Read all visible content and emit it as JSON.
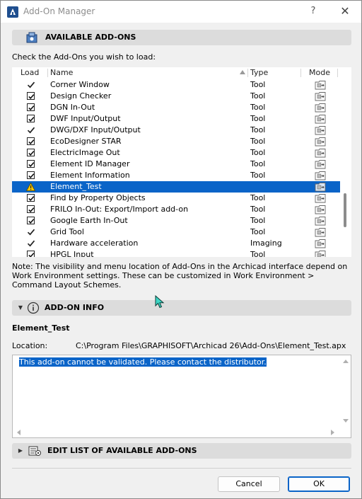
{
  "window": {
    "title": "Add-On Manager",
    "help_label": "?",
    "close_label": "✕"
  },
  "available": {
    "header": "AVAILABLE ADD-ONS",
    "instruction": "Check the Add-Ons you wish to load:"
  },
  "table": {
    "columns": {
      "load": "Load",
      "name": "Name",
      "type": "Type",
      "mode": "Mode"
    },
    "rows": [
      {
        "name": "Corner Window",
        "type": "Tool",
        "load": "tick"
      },
      {
        "name": "Design Checker",
        "type": "Tool",
        "load": "checked"
      },
      {
        "name": "DGN In-Out",
        "type": "Tool",
        "load": "checked"
      },
      {
        "name": "DWF Input/Output",
        "type": "Tool",
        "load": "checked"
      },
      {
        "name": "DWG/DXF Input/Output",
        "type": "Tool",
        "load": "tick"
      },
      {
        "name": "EcoDesigner STAR",
        "type": "Tool",
        "load": "checked"
      },
      {
        "name": "ElectricImage Out",
        "type": "Tool",
        "load": "checked"
      },
      {
        "name": "Element ID Manager",
        "type": "Tool",
        "load": "checked"
      },
      {
        "name": "Element Information",
        "type": "Tool",
        "load": "checked"
      },
      {
        "name": "Element_Test",
        "type": "",
        "load": "warning",
        "selected": true
      },
      {
        "name": "Find by Property Objects",
        "type": "Tool",
        "load": "checked"
      },
      {
        "name": "FRILO In-Out: Export/Import add-on",
        "type": "Tool",
        "load": "checked"
      },
      {
        "name": "Google Earth In-Out",
        "type": "Tool",
        "load": "checked"
      },
      {
        "name": "Grid Tool",
        "type": "Tool",
        "load": "tick"
      },
      {
        "name": "Hardware acceleration",
        "type": "Imaging",
        "load": "tick"
      },
      {
        "name": "HPGL Input",
        "type": "Tool",
        "load": "checked"
      }
    ]
  },
  "note": "Note: The visibility and menu location of Add-Ons in the Archicad interface depend on Work Environment settings. These can be customized in Work Environment > Command Layout Schemes.",
  "info": {
    "header": "ADD-ON INFO",
    "selected_name": "Element_Test",
    "location_label": "Location:",
    "location_value": "C:\\Program Files\\GRAPHISOFT\\Archicad 26\\Add-Ons\\Element_Test.apx",
    "message": "This add-on cannot be validated. Please contact the distributor."
  },
  "edit_list": {
    "header": "EDIT LIST OF AVAILABLE ADD-ONS"
  },
  "buttons": {
    "cancel": "Cancel",
    "ok": "OK"
  },
  "colors": {
    "selection": "#0a64c8",
    "section_bg": "#dcdcdc",
    "warning": "#f5c400"
  }
}
